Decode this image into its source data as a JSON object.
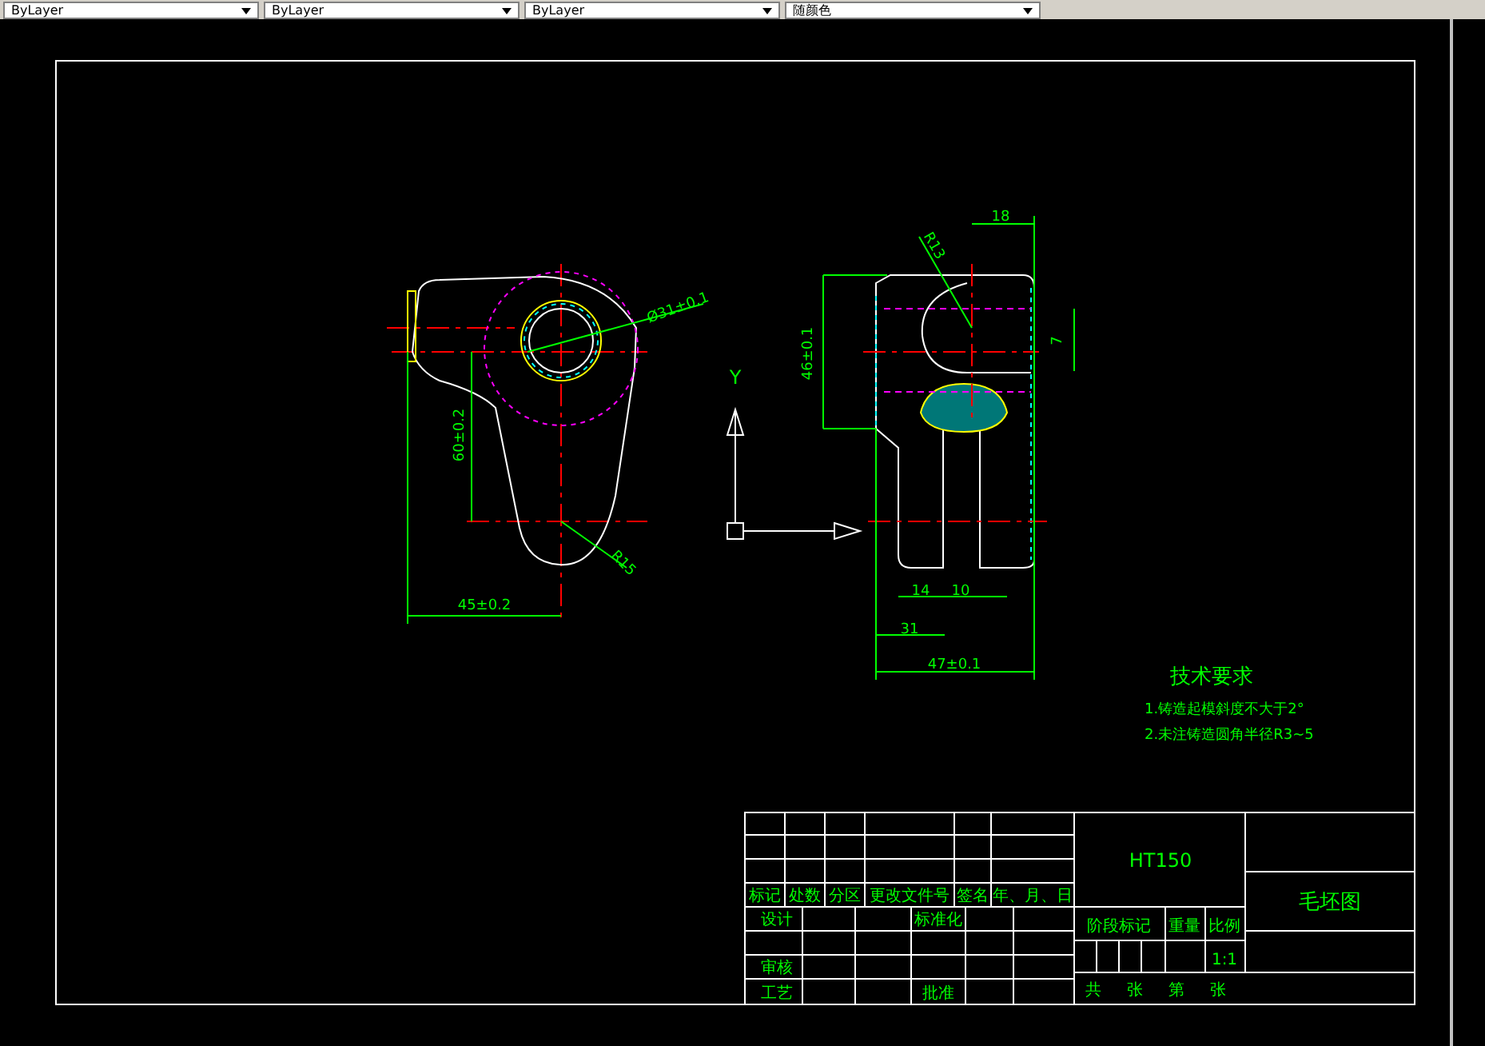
{
  "toolbar": {
    "dropdowns": [
      {
        "value": "ByLayer"
      },
      {
        "value": "ByLayer"
      },
      {
        "value": "ByLayer"
      },
      {
        "value": "随颜色"
      }
    ]
  },
  "drawing": {
    "front_view_dimensions": [
      "Ø31±0.1",
      "60±0.2",
      "R15",
      "45±0.2"
    ],
    "side_view_dimensions": [
      "18",
      "R13",
      "46±0.1",
      "7",
      "14",
      "10",
      "31",
      "47±0.1"
    ],
    "axis_labels": [
      "Y"
    ]
  },
  "technical_requirements": {
    "title": "技术要求",
    "items": [
      "1.铸造起模斜度不大于2°",
      "2.未注铸造圆角半径R3~5"
    ]
  },
  "title_block": {
    "material": "HT150",
    "drawing_title": "毛坯图",
    "revision_headers": [
      "标记",
      "处数",
      "分区",
      "更改文件号",
      "签名",
      "年、月、日"
    ],
    "roles": [
      "设计",
      "标准化",
      "审核",
      "工艺",
      "批准"
    ],
    "stage_headers": [
      "阶段标记",
      "重量",
      "比例"
    ],
    "scale": "1:1",
    "sheet_labels": [
      "共",
      "张",
      "第",
      "张"
    ]
  }
}
